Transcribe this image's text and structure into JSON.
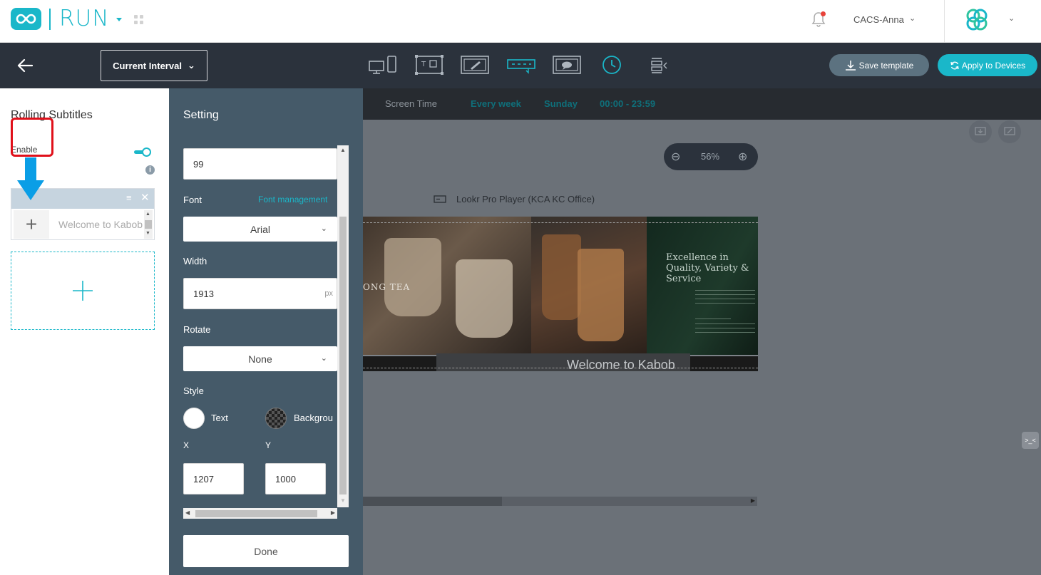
{
  "header": {
    "app_name": "RUN",
    "user_name": "CACS-Anna",
    "user_caret": "⌄",
    "brand_caret": "⌄",
    "colors": {
      "accent": "#1ab7c9",
      "notification": "#e8423a"
    }
  },
  "toolbar": {
    "interval_label": "Current Interval",
    "interval_caret": "⌄",
    "save_label": "Save template",
    "apply_label": "Apply to Devices",
    "mode_icons": [
      "multi-screen-icon",
      "text-qr-widget-icon",
      "image-editor-icon",
      "rolling-subtitles-icon",
      "message-screen-icon",
      "clock-icon",
      "align-right-icon"
    ],
    "active_mode": "rolling-subtitles-icon"
  },
  "left_panel": {
    "title": "Rolling Subtitles",
    "enable_label": "Enable",
    "enabled": true,
    "info_glyph": "i",
    "item": {
      "text": "Welcome to Kabob",
      "menu_glyph": "≡",
      "close_glyph": "✕",
      "plus_glyph": "+"
    }
  },
  "setting": {
    "title": "Setting",
    "top_value": "99",
    "font_label": "Font",
    "font_management": "Font management",
    "font_value": "Arial",
    "width_label": "Width",
    "width_value": "1913",
    "width_unit": "px",
    "rotate_label": "Rotate",
    "rotate_value": "None",
    "style_label": "Style",
    "text_color_label": "Text",
    "background_label": "Backgrou",
    "x_label": "X",
    "y_label": "Y",
    "x_value": "1207",
    "y_value": "1000",
    "done_label": "Done",
    "select_caret": "⌄"
  },
  "canvas": {
    "schedule": {
      "label": "Screen Time",
      "frequency": "Every week",
      "day": "Sunday",
      "time": "00:00 - 23:59"
    },
    "zoom": {
      "value": "56%",
      "minus_glyph": "⊖",
      "plus_glyph": "⊕"
    },
    "device_name": "Lookr Pro Player (KCA KC Office)",
    "preview": {
      "caption_left": "ONG TEA",
      "headline": "Excellence in Quality, Variety & Service",
      "marquee_text": "Welcome to Kabob"
    },
    "side_tab_glyph": ">_<"
  }
}
